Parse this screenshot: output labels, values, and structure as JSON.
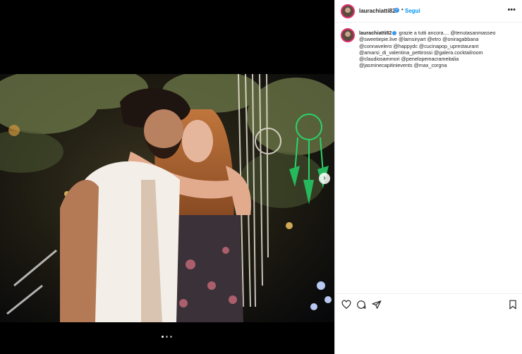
{
  "post": {
    "username": "laurachiatti82",
    "follow_label": "Segui",
    "separator": "•",
    "more_label": "•••",
    "caption_username": "laurachiatti82",
    "caption_lines": [
      "grazie a tutti ancora.... @tenutasanmasseo",
      "@sweetiepie.live @lamsiryart @etro @oniragabbana",
      "@connavelero @happydc @cucinapop_uprestaurant",
      "@amarsi_di_valentina_pettirossi @galera.cocktailroom",
      "@claudiosammori @penelopemacrameitalia",
      "@jasminecapitinievents @max_corgna"
    ]
  },
  "carousel": {
    "total": 3,
    "active": 1
  },
  "icons": {
    "verified": "verified-badge-icon",
    "more": "more-options-icon",
    "like": "heart-icon",
    "comment": "comment-icon",
    "share": "share-icon",
    "save": "bookmark-icon",
    "next": "chevron-right-icon"
  },
  "colors": {
    "accent": "#0095f6",
    "verified": "#3897f0",
    "text": "#262626",
    "dreamcatcher": "#2bd36b"
  }
}
